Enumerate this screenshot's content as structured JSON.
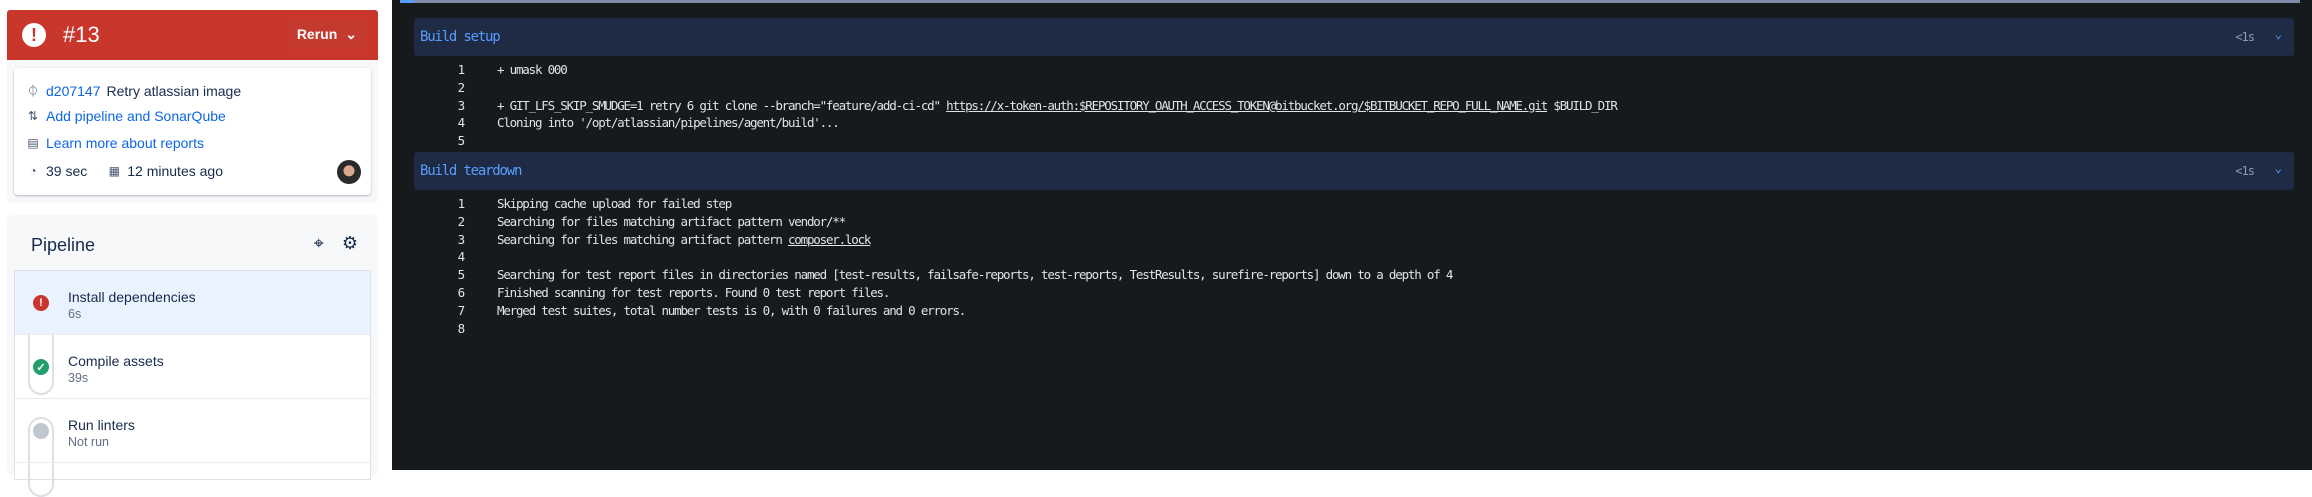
{
  "run": {
    "number": "#13",
    "rerun_label": "Rerun",
    "commit_hash": "d207147",
    "commit_message": "Retry atlassian image",
    "pr_link": "Add pipeline and SonarQube",
    "reports_link": "Learn more about reports",
    "duration": "39 sec",
    "time_ago": "12 minutes ago"
  },
  "pipeline": {
    "title": "Pipeline",
    "steps": [
      {
        "name": "Install dependencies",
        "duration": "6s",
        "status": "failed"
      },
      {
        "name": "Compile assets",
        "duration": "39s",
        "status": "success"
      },
      {
        "name": "Run linters",
        "duration": "Not run",
        "status": "not-run"
      }
    ]
  },
  "log": {
    "sections": [
      {
        "title": "Build setup",
        "duration": "<1s",
        "lines": [
          {
            "n": "1",
            "text": "+ umask 000"
          },
          {
            "n": "2",
            "text": ""
          },
          {
            "n": "3",
            "pre": "+ GIT_LFS_SKIP_SMUDGE=1 retry 6 git clone --branch=\"feature/add-ci-cd\" ",
            "link": "https://x-token-auth:$REPOSITORY_OAUTH_ACCESS_TOKEN@bitbucket.org/$BITBUCKET_REPO_FULL_NAME.git",
            "post": " $BUILD_DIR"
          },
          {
            "n": "4",
            "text": "Cloning into '/opt/atlassian/pipelines/agent/build'..."
          },
          {
            "n": "5",
            "text": ""
          }
        ]
      },
      {
        "title": "Build teardown",
        "duration": "<1s",
        "lines": [
          {
            "n": "1",
            "text": "Skipping cache upload for failed step"
          },
          {
            "n": "2",
            "text": "Searching for files matching artifact pattern vendor/**"
          },
          {
            "n": "3",
            "pre": "Searching for files matching artifact pattern ",
            "link": "composer.lock",
            "post": ""
          },
          {
            "n": "4",
            "text": ""
          },
          {
            "n": "5",
            "text": "Searching for test report files in directories named [test-results, failsafe-reports, test-reports, TestResults, surefire-reports] down to a depth of 4"
          },
          {
            "n": "6",
            "text": "Finished scanning for test reports. Found 0 test report files."
          },
          {
            "n": "7",
            "text": "Merged test suites, total number tests is 0, with 0 failures and 0 errors."
          },
          {
            "n": "8",
            "text": ""
          }
        ]
      }
    ]
  }
}
